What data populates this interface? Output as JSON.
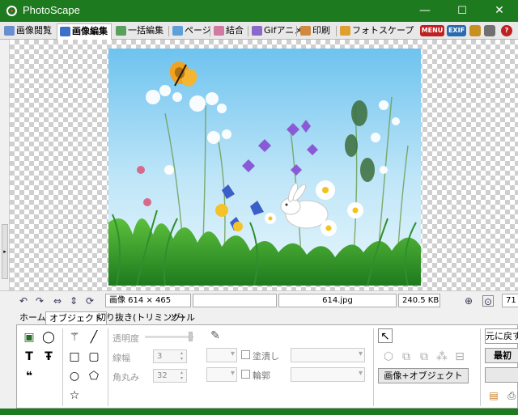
{
  "window": {
    "title": "PhotoScape",
    "minimize": "—",
    "maximize": "☐",
    "close": "✕",
    "accent": "#1e7a1e"
  },
  "tabs": [
    {
      "label": "画像閲覧",
      "icon": "viewer-icon",
      "active": false
    },
    {
      "label": "画像編集",
      "icon": "editor-icon",
      "active": true
    },
    {
      "label": "一括編集",
      "icon": "batch-icon",
      "active": false
    },
    {
      "label": "ページ",
      "icon": "page-icon",
      "active": false
    },
    {
      "label": "結合",
      "icon": "combine-icon",
      "active": false
    },
    {
      "label": "Gifアニメ",
      "icon": "gif-icon",
      "active": false
    },
    {
      "label": "印刷",
      "icon": "print-icon",
      "active": false
    },
    {
      "label": "フォトスケープ",
      "icon": "photoscape-icon",
      "active": false
    }
  ],
  "right_buttons": {
    "menu": "MENU",
    "exif": "EXIF"
  },
  "status": {
    "image_size": "画像 614 × 465",
    "filename": "614.jpg",
    "filesize": "240.5 KB",
    "zoom": "71"
  },
  "panel": {
    "tabs": [
      "ホーム",
      "オブジェクト",
      "切り抜き(トリミング)",
      "ツール"
    ],
    "active_tab": 1,
    "opacity_label": "透明度",
    "line_width_label": "線幅",
    "line_width_value": "3",
    "corner_label": "角丸み",
    "corner_value": "32",
    "fill_label": "塗潰し",
    "outline_label": "輪郭",
    "image_object_button": "画像+オブジェクト",
    "undo_button": "元に戻す",
    "latest_button": "最初"
  }
}
